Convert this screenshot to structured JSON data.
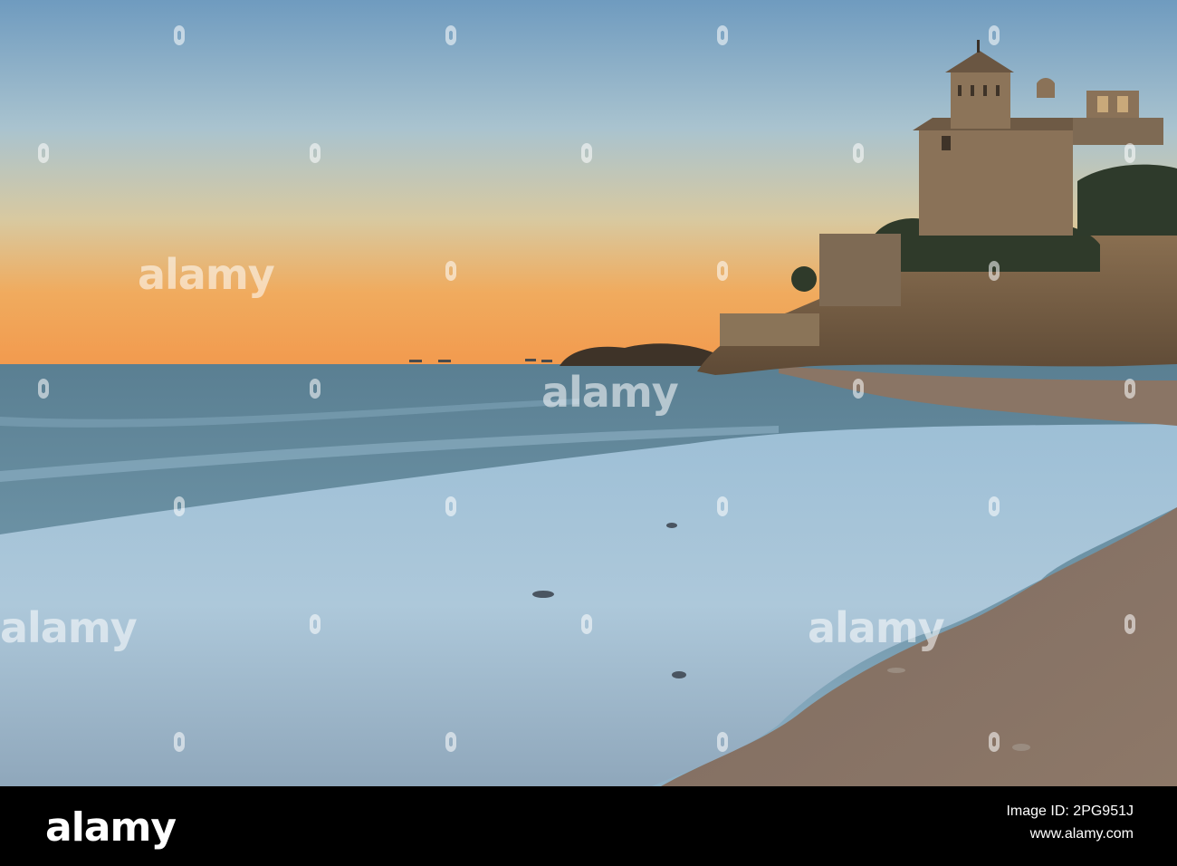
{
  "scene": {
    "subject": "castle-on-rocky-cliff",
    "colors": {
      "sky_top": "#6d98bd",
      "sky_mid": "#b8c9c8",
      "sky_horizon": "#f2a75a",
      "sea": "#5c7e8e",
      "foam": "#b9d3e4",
      "sand": "#8a7565",
      "rock": "#7a6246",
      "castle": "#8a7258"
    }
  },
  "watermark": {
    "text": "alamy",
    "icon": "alamy-pin-icon"
  },
  "footer": {
    "logo": "alamy",
    "image_id_label": "Image ID: 2PG951J",
    "url": "www.alamy.com"
  }
}
